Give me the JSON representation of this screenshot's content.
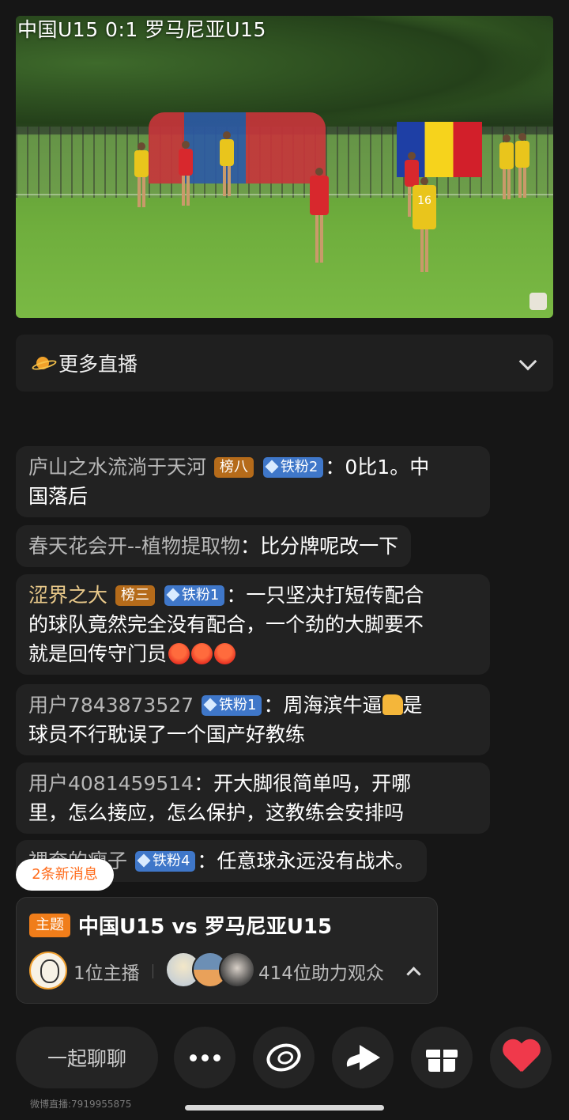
{
  "video": {
    "title": "中国U15 0:1 罗马尼亚U15",
    "jersey_number": "16"
  },
  "more_live": {
    "label": "更多直播",
    "icon": "planet-icon"
  },
  "comments": [
    {
      "user": "庐山之水流淌于天河",
      "rank_badge": "榜八",
      "fan_badge": "铁粉2",
      "text_line1": "0比1。中",
      "text_line2": "国落后"
    },
    {
      "user": "春天花会开--植物提取物",
      "text": "比分牌呢改一下"
    },
    {
      "user": "涩界之大",
      "rank_badge": "榜三",
      "fan_badge": "铁粉1",
      "text_line1": "一只坚决打短传配合",
      "text_line2": "的球队竟然完全没有配合，一个劲的大脚要不",
      "text_line3": "就是回传守门员"
    },
    {
      "user": "用户7843873527",
      "fan_badge": "铁粉1",
      "text_line1": "周海滨牛逼",
      "text_line1b": "是",
      "text_line2": "球员不行耽误了一个国产好教练"
    },
    {
      "user": "用户4081459514",
      "text_line1": "开大脚很简单吗，开哪",
      "text_line2": "里，怎么接应，怎么保护，这教练会安排吗"
    },
    {
      "user": "裸奔的瘦子",
      "fan_badge": "铁粉4",
      "text": "任意球永远没有战术。"
    }
  ],
  "new_messages": "2条新消息",
  "topic": {
    "tag": "主题",
    "title": "中国U15 vs 罗马尼亚U15",
    "hosts": "1位主播",
    "fans": "414位助力观众"
  },
  "bottom_bar": {
    "chat_label": "一起聊聊"
  },
  "room_id": "微博直播:7919955875",
  "colors": {
    "background": "#161616",
    "accent": "#f07d1a",
    "fan_badge": "#3f77c9",
    "rank_badge": "#b56b1a",
    "heart": "#f0394b"
  }
}
